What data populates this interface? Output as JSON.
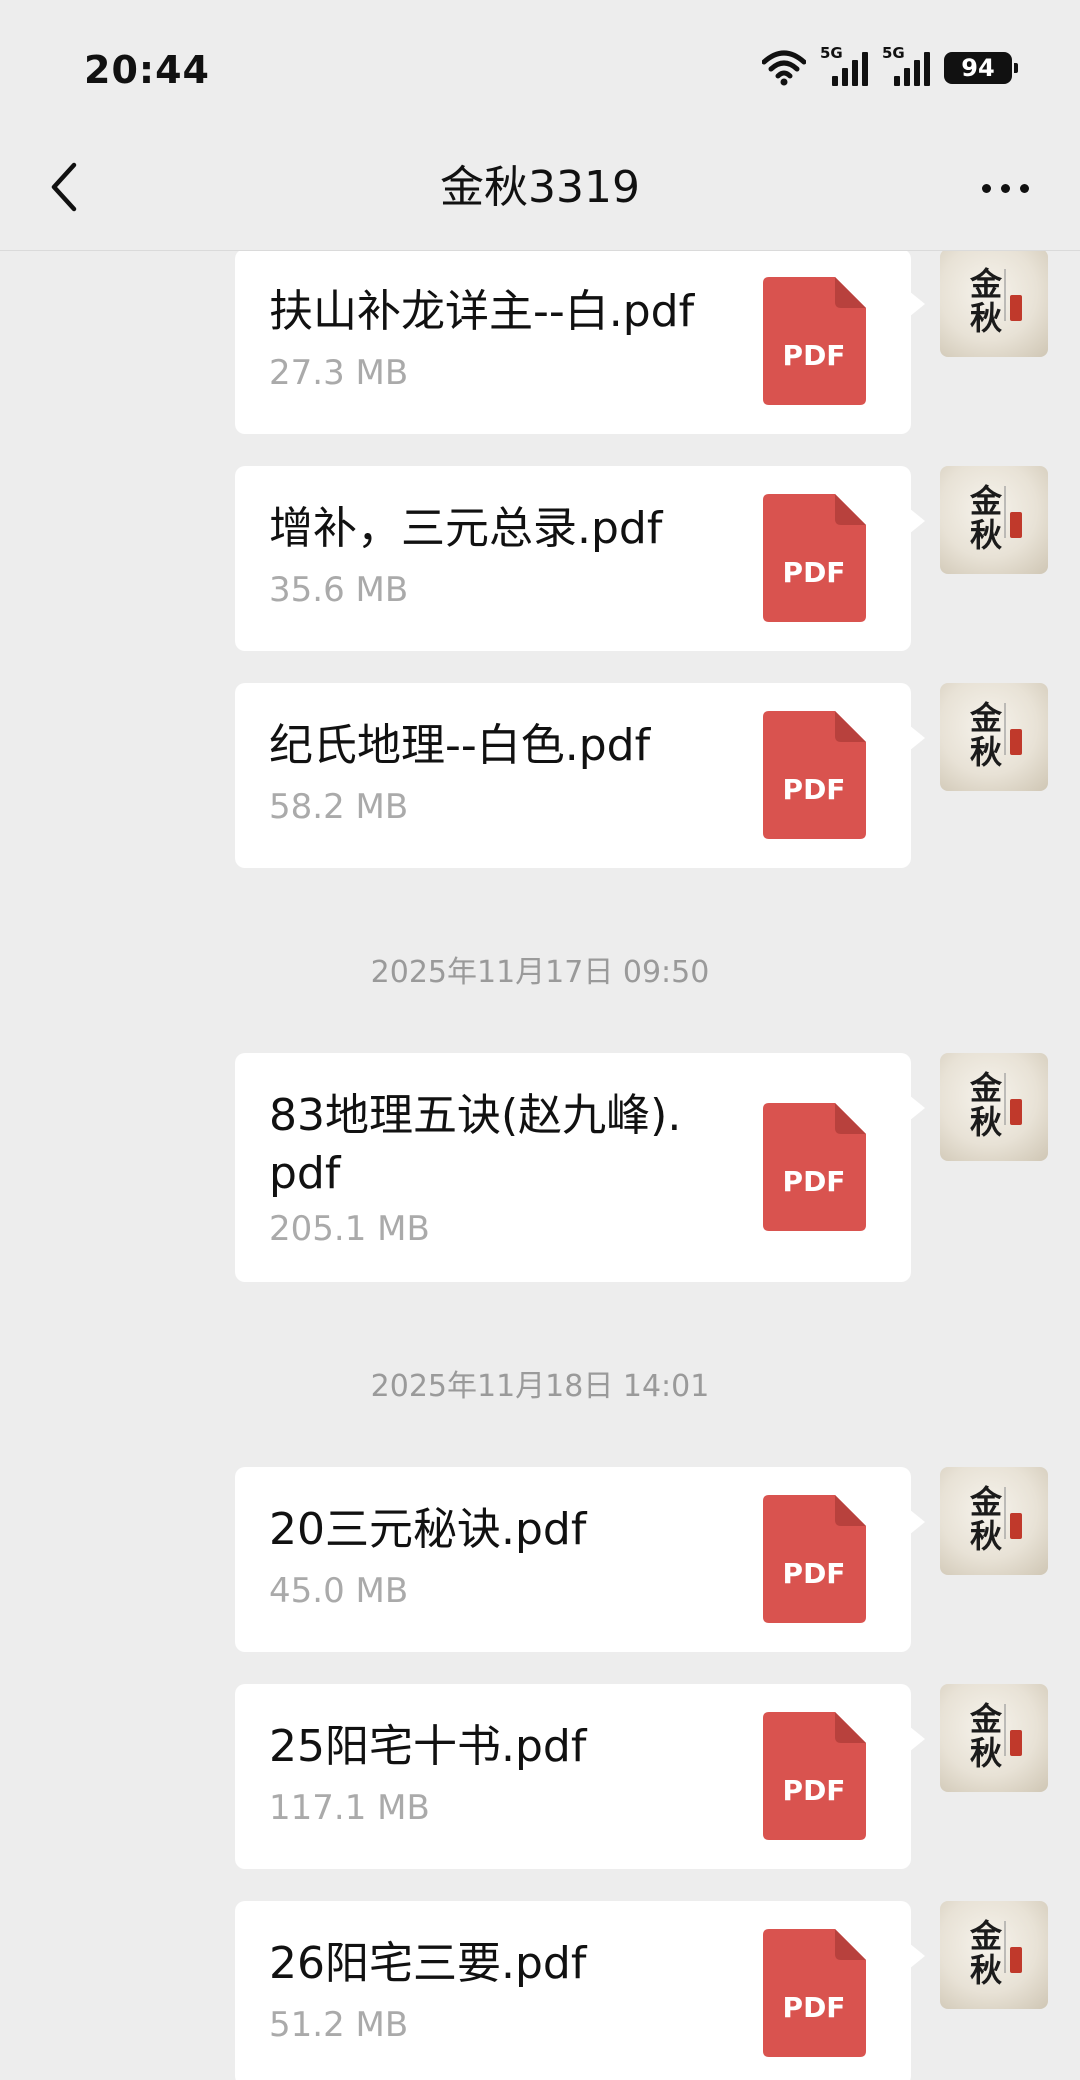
{
  "status_bar": {
    "time": "20:44",
    "network_1": "5G",
    "network_2": "5G",
    "battery": "94"
  },
  "nav": {
    "title": "金秋3319"
  },
  "avatar": {
    "char_1": "金",
    "char_2": "秋"
  },
  "messages": [
    {
      "file_name": "扶山补龙详主--白.pdf",
      "size": "27.3 MB",
      "icon_label": "PDF"
    },
    {
      "file_name": "增补，三元总录.pdf",
      "size": "35.6 MB",
      "icon_label": "PDF"
    },
    {
      "file_name": "纪氏地理--白色.pdf",
      "size": "58.2 MB",
      "icon_label": "PDF"
    },
    {
      "file_name": "83地理五诀(赵九峰).pdf",
      "size": "205.1 MB",
      "icon_label": "PDF"
    },
    {
      "file_name": "20三元秘诀.pdf",
      "size": "45.0 MB",
      "icon_label": "PDF"
    },
    {
      "file_name": "25阳宅十书.pdf",
      "size": "117.1 MB",
      "icon_label": "PDF"
    },
    {
      "file_name": "26阳宅三要.pdf",
      "size": "51.2 MB",
      "icon_label": "PDF"
    }
  ],
  "timestamps": [
    "2025年11月17日 09:50",
    "2025年11月18日 14:01"
  ],
  "colors": {
    "pdf_red": "#d9534f",
    "pdf_fold": "#b8413d",
    "background": "#ededed"
  }
}
